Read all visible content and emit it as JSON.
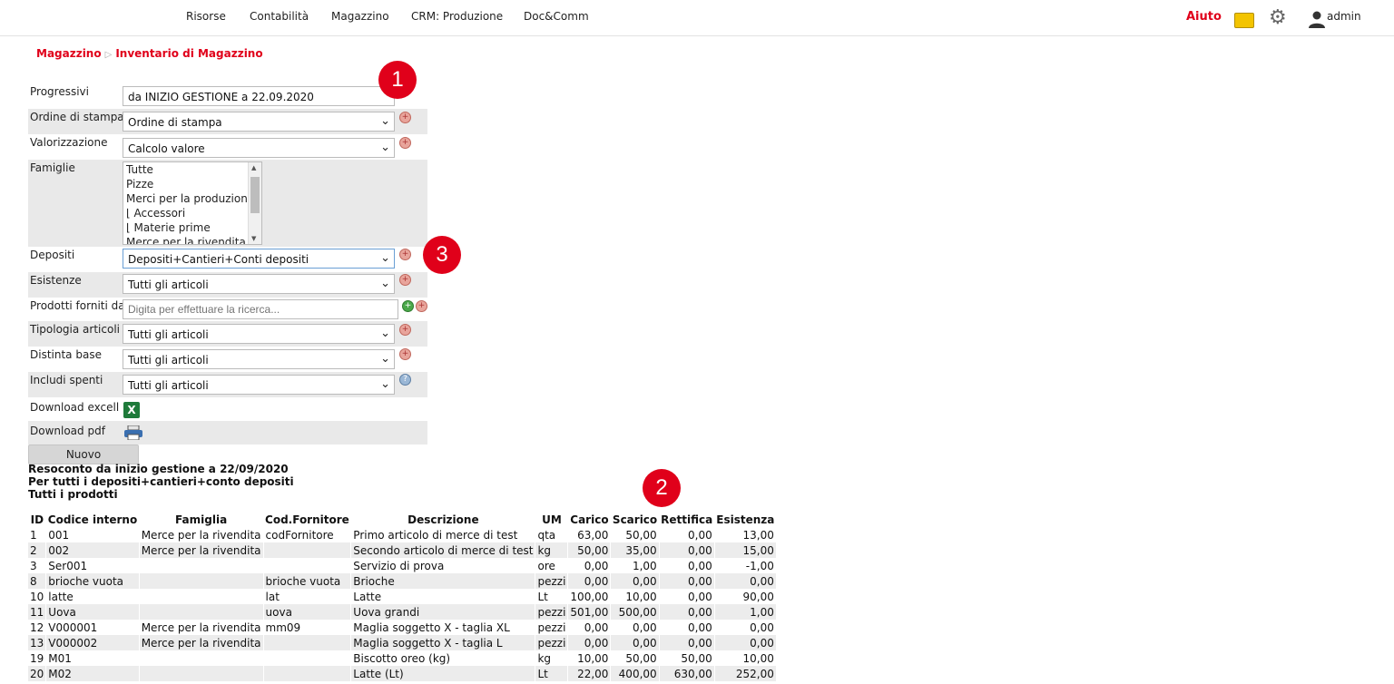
{
  "nav": {
    "items": [
      "Risorse",
      "Contabilità",
      "Magazzino",
      "CRM: Produzione",
      "Doc&Comm"
    ],
    "help": "Aiuto",
    "user": "admin"
  },
  "breadcrumb": {
    "parent": "Magazzino",
    "current": "Inventario di Magazzino"
  },
  "form": {
    "progressivi": {
      "label": "Progressivi",
      "value": "da INIZIO GESTIONE a 22.09.2020"
    },
    "ordine": {
      "label": "Ordine di stampa",
      "value": "Ordine di stampa"
    },
    "valorizzazione": {
      "label": "Valorizzazione",
      "value": "Calcolo valore"
    },
    "famiglie": {
      "label": "Famiglie",
      "options": [
        "Tutte",
        "Pizze",
        "Merci per la produzione",
        "⌊ Accessori",
        "⌊ Materie prime",
        "Merce per la rivendita"
      ]
    },
    "depositi": {
      "label": "Depositi",
      "value": "Depositi+Cantieri+Conti depositi"
    },
    "esistenze": {
      "label": "Esistenze",
      "value": "Tutti gli articoli"
    },
    "prodotti": {
      "label": "Prodotti forniti da",
      "placeholder": "Digita per effettuare la ricerca..."
    },
    "tipologia": {
      "label": "Tipologia articoli",
      "value": "Tutti gli articoli"
    },
    "distinta": {
      "label": "Distinta base",
      "value": "Tutti gli articoli"
    },
    "spenti": {
      "label": "Includi spenti",
      "value": "Tutti gli articoli"
    },
    "excel": {
      "label": "Download excell"
    },
    "pdf": {
      "label": "Download pdf"
    }
  },
  "new_button": "Nuovo",
  "summary": {
    "line1": "Resoconto da inizio gestione a 22/09/2020",
    "line2": "Per tutti i depositi+cantieri+conto depositi",
    "line3": "Tutti i prodotti"
  },
  "badges": [
    "1",
    "2",
    "3"
  ],
  "table": {
    "headers": [
      "ID",
      "Codice interno",
      "Famiglia",
      "Cod.Fornitore",
      "Descrizione",
      "UM",
      "Carico",
      "Scarico",
      "Rettifica",
      "Esistenza"
    ],
    "rows": [
      [
        "1",
        "001",
        "Merce per la rivendita",
        "codFornitore",
        "Primo articolo di merce di test",
        "qta",
        "63,00",
        "50,00",
        "0,00",
        "13,00"
      ],
      [
        "2",
        "002",
        "Merce per la rivendita",
        "",
        "Secondo articolo di merce di test",
        "kg",
        "50,00",
        "35,00",
        "0,00",
        "15,00"
      ],
      [
        "3",
        "Ser001",
        "",
        "",
        "Servizio di prova",
        "ore",
        "0,00",
        "1,00",
        "0,00",
        "-1,00"
      ],
      [
        "8",
        "brioche vuota",
        "",
        "brioche vuota",
        "Brioche",
        "pezzi",
        "0,00",
        "0,00",
        "0,00",
        "0,00"
      ],
      [
        "10",
        "latte",
        "",
        "lat",
        "Latte",
        "Lt",
        "100,00",
        "10,00",
        "0,00",
        "90,00"
      ],
      [
        "11",
        "Uova",
        "",
        "uova",
        "Uova grandi",
        "pezzi",
        "501,00",
        "500,00",
        "0,00",
        "1,00"
      ],
      [
        "12",
        "V000001",
        "Merce per la rivendita",
        "mm09",
        "Maglia soggetto X - taglia XL",
        "pezzi",
        "0,00",
        "0,00",
        "0,00",
        "0,00"
      ],
      [
        "13",
        "V000002",
        "Merce per la rivendita",
        "",
        "Maglia soggetto X - taglia L",
        "pezzi",
        "0,00",
        "0,00",
        "0,00",
        "0,00"
      ],
      [
        "19",
        "M01",
        "",
        "",
        "Biscotto oreo (kg)",
        "kg",
        "10,00",
        "50,00",
        "50,00",
        "10,00"
      ],
      [
        "20",
        "M02",
        "",
        "",
        "Latte (Lt)",
        "Lt",
        "22,00",
        "400,00",
        "630,00",
        "252,00"
      ]
    ]
  }
}
